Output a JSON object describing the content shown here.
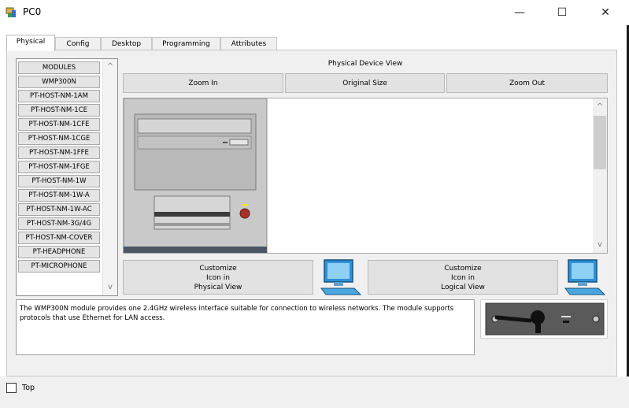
{
  "window": {
    "title": "PC0",
    "minimize_glyph": "—",
    "maximize_glyph": "☐",
    "close_glyph": "✕"
  },
  "tabs": [
    "Physical",
    "Config",
    "Desktop",
    "Programming",
    "Attributes"
  ],
  "active_tab": "Physical",
  "modules": {
    "items": [
      "MODULES",
      "WMP300N",
      "PT-HOST-NM-1AM",
      "PT-HOST-NM-1CE",
      "PT-HOST-NM-1CFE",
      "PT-HOST-NM-1CGE",
      "PT-HOST-NM-1FFE",
      "PT-HOST-NM-1FGE",
      "PT-HOST-NM-1W",
      "PT-HOST-NM-1W-A",
      "PT-HOST-NM-1W-AC",
      "PT-HOST-NM-3G/4G",
      "PT-HOST-NM-COVER",
      "PT-HEADPHONE",
      "PT-MICROPHONE"
    ],
    "scroll_up": "^",
    "scroll_down": "v"
  },
  "physical_view": {
    "label": "Physical Device View",
    "zoom_in": "Zoom In",
    "original_size": "Original Size",
    "zoom_out": "Zoom Out",
    "scroll_up": "^",
    "scroll_down": "v"
  },
  "customize_physical": {
    "line1": "Customize",
    "line2": "Icon in",
    "line3": "Physical View"
  },
  "customize_logical": {
    "line1": "Customize",
    "line2": "Icon in",
    "line3": "Logical View"
  },
  "description": "The WMP300N module provides one 2.4GHz wireless interface suitable for connection to wireless networks. The module supports protocols that use Ethernet for LAN access.",
  "bottom": {
    "top_label": "Top",
    "top_checked": false
  },
  "colors": {
    "accent_blue": "#2f8fd6",
    "tower_gray": "#c8c8c8",
    "module_dark": "#5a5a5a"
  },
  "icons": [
    "pc-app-icon",
    "computer-monitor-icon",
    "wireless-module-icon",
    "pc-tower-icon"
  ]
}
